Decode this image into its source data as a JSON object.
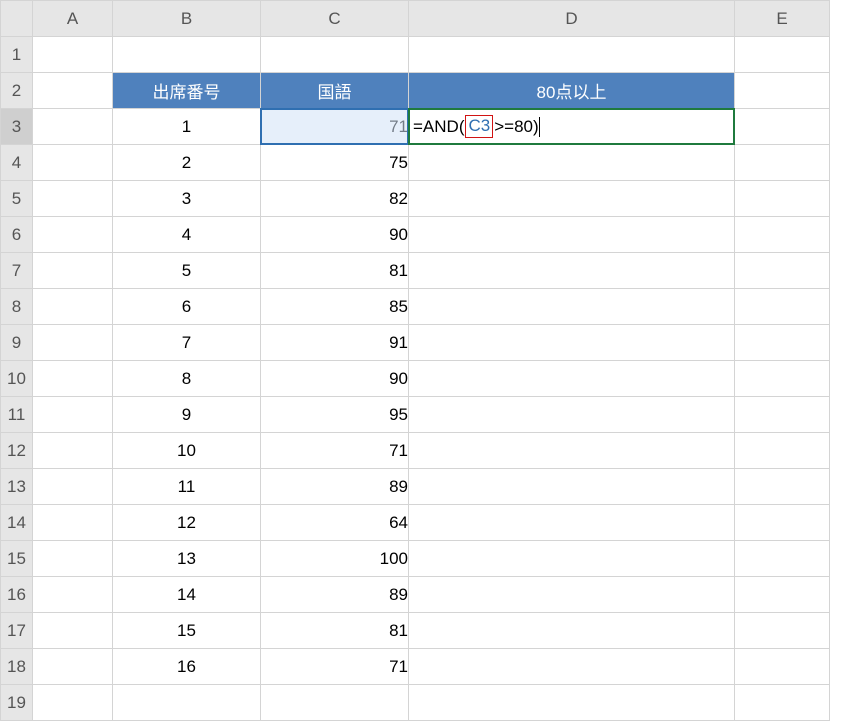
{
  "columns": [
    "A",
    "B",
    "C",
    "D",
    "E"
  ],
  "rows": [
    "1",
    "2",
    "3",
    "4",
    "5",
    "6",
    "7",
    "8",
    "9",
    "10",
    "11",
    "12",
    "13",
    "14",
    "15",
    "16",
    "17",
    "18",
    "19"
  ],
  "header": {
    "b": "出席番号",
    "c": "国語",
    "d": "80点以上"
  },
  "formula": {
    "prefix": "=AND(",
    "ref": "C3",
    "tail": ">=80)"
  },
  "chart_data": {
    "type": "table",
    "columns": [
      "出席番号",
      "国語",
      "80点以上"
    ],
    "rows": [
      {
        "id": 1,
        "score": 71
      },
      {
        "id": 2,
        "score": 75
      },
      {
        "id": 3,
        "score": 82
      },
      {
        "id": 4,
        "score": 90
      },
      {
        "id": 5,
        "score": 81
      },
      {
        "id": 6,
        "score": 85
      },
      {
        "id": 7,
        "score": 91
      },
      {
        "id": 8,
        "score": 90
      },
      {
        "id": 9,
        "score": 95
      },
      {
        "id": 10,
        "score": 71
      },
      {
        "id": 11,
        "score": 89
      },
      {
        "id": 12,
        "score": 64
      },
      {
        "id": 13,
        "score": 100
      },
      {
        "id": 14,
        "score": 89
      },
      {
        "id": 15,
        "score": 81
      },
      {
        "id": 16,
        "score": 71
      }
    ]
  }
}
